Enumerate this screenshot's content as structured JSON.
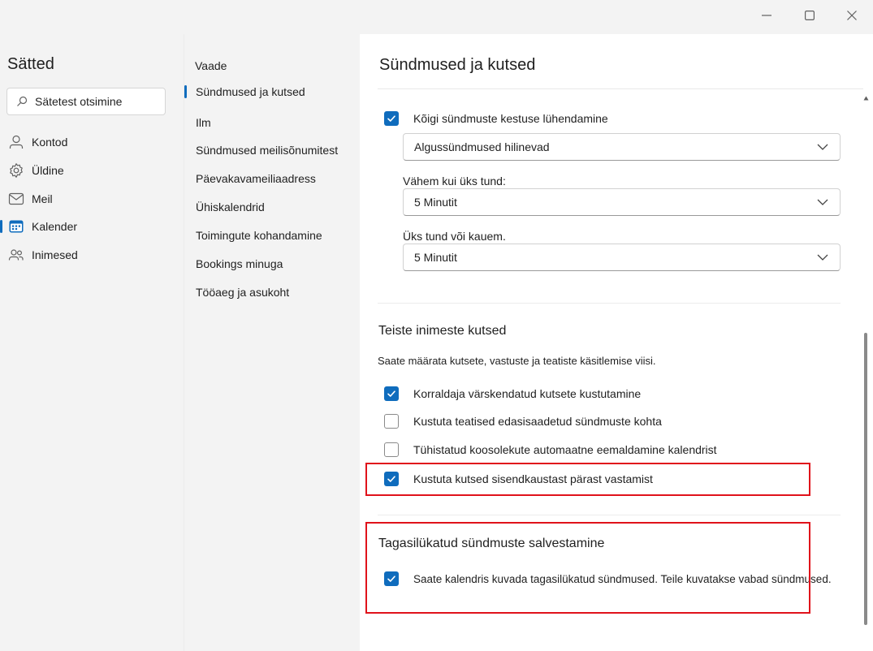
{
  "window_controls": {
    "minimize": "minimize",
    "maximize": "maximize",
    "close": "close"
  },
  "sidebar": {
    "title": "Sätted",
    "search_placeholder": "Sätetest otsimine",
    "items": [
      {
        "label": "Kontod",
        "icon": "person-icon"
      },
      {
        "label": "Üldine",
        "icon": "gear-icon"
      },
      {
        "label": "Meil",
        "icon": "mail-icon"
      },
      {
        "label": "Kalender",
        "icon": "calendar-icon"
      },
      {
        "label": "Inimesed",
        "icon": "people-icon"
      }
    ],
    "active_index": 3
  },
  "subnav": {
    "heading": "Vaade",
    "items": [
      "Sündmused ja kutsed",
      "Ilm",
      "Sündmused meilisõnumitest",
      "Päevakavameiliaadress",
      "Ühiskalendrid",
      "Toimingute kohandamine",
      "Bookings minuga",
      "Tööaeg ja asukoht"
    ],
    "active_index": 0
  },
  "content": {
    "title": "Sündmused ja kutsed",
    "shorten": {
      "label": "Kõigi sündmuste kestuse lühendamine",
      "checked": true,
      "mode_value": "Algussündmused hilinevad",
      "under_hour_label": "Vähem kui üks tund:",
      "under_hour_value": "5 Minutit",
      "over_hour_label": "Üks tund või kauem.",
      "over_hour_value": "5 Minutit"
    },
    "invites": {
      "title": "Teiste inimeste kutsed",
      "description": "Saate määrata kutsete, vastuste ja teatiste käsitlemise viisi.",
      "options": [
        {
          "label": "Korraldaja värskendatud kutsete kustutamine",
          "checked": true
        },
        {
          "label": "Kustuta teatised edasisaadetud sündmuste kohta",
          "checked": false
        },
        {
          "label": "Tühistatud koosolekute automaatne eemaldamine kalendrist",
          "checked": false
        },
        {
          "label": "Kustuta kutsed sisendkaustast pärast vastamist",
          "checked": true
        }
      ]
    },
    "declined": {
      "title": "Tagasilükatud sündmuste salvestamine",
      "option": {
        "label": "Saate kalendris kuvada tagasilükatud sündmused. Teile kuvatakse vabad sündmused.",
        "checked": true
      }
    }
  },
  "colors": {
    "accent": "#0f6cbd",
    "highlight": "#e0121b"
  }
}
